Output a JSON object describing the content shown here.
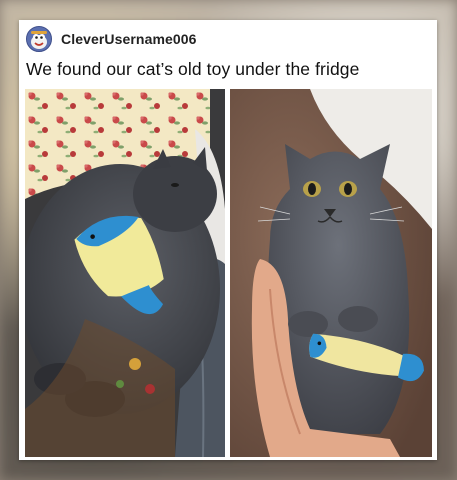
{
  "post": {
    "username": "CleverUsername006",
    "title": "We found our cat’s old toy under the fridge"
  },
  "icons": {
    "avatar": "cartoon-face-avatar-icon"
  },
  "colors": {
    "card_background": "#ffffff",
    "text": "#111111",
    "avatar": "#5b6fb0"
  }
}
